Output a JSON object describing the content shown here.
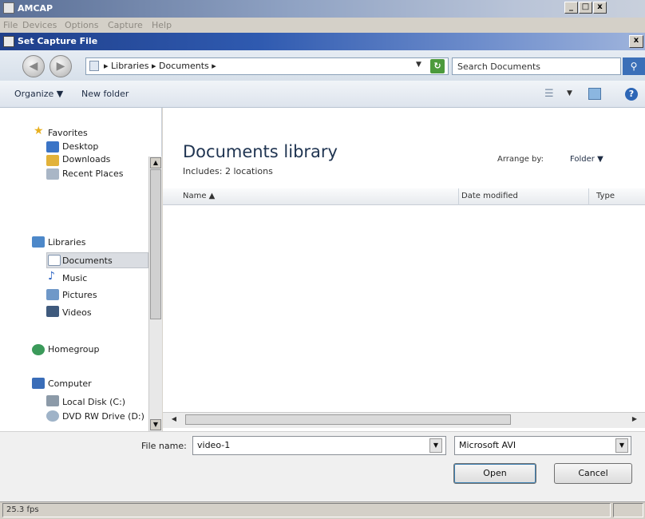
{
  "app": {
    "title": "AMCAP",
    "menu": [
      "File",
      "Devices",
      "Options",
      "Capture",
      "Help"
    ],
    "buttons": {
      "minimize": "_",
      "maximize": "□",
      "close": "x"
    }
  },
  "dialog": {
    "title": "Set Capture File",
    "close_label": "x"
  },
  "address": {
    "path_text": "▸ Libraries ▸ Documents ▸",
    "dropdown": "▼",
    "search_placeholder": "Search Documents"
  },
  "toolbar": {
    "organize_label": "Organize ▼",
    "new_folder_label": "New folder",
    "views_dropdown": "▼"
  },
  "nav": {
    "favorites_label": "Favorites",
    "desktop_label": "Desktop",
    "downloads_label": "Downloads",
    "recent_label": "Recent Places",
    "libraries_label": "Libraries",
    "documents_label": "Documents",
    "music_label": "Music",
    "pictures_label": "Pictures",
    "videos_label": "Videos",
    "homegroup_label": "Homegroup",
    "computer_label": "Computer",
    "local_disk_label": "Local Disk (C:)",
    "dvd_label": "DVD RW Drive (D:)"
  },
  "content": {
    "library_title": "Documents library",
    "includes_text": "Includes:  2 locations",
    "arrange_label": "Arrange by:",
    "arrange_value": "Folder  ▼",
    "columns": [
      "Name ▲",
      "Date modified",
      "Type"
    ]
  },
  "bottom": {
    "file_name_label": "File name:",
    "file_name_value": "video-1",
    "file_type_value": "Microsoft AVI",
    "open_label": "Open",
    "cancel_label": "Cancel"
  },
  "status": {
    "fps": "25.3 fps"
  }
}
